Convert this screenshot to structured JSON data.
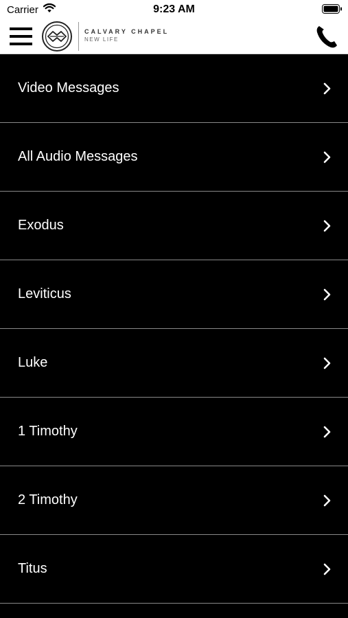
{
  "status_bar": {
    "carrier": "Carrier",
    "time": "9:23 AM",
    "wifi_icon": "wifi-icon",
    "battery_icon": "battery-icon"
  },
  "header": {
    "menu_icon": "hamburger-menu-icon",
    "logo_icon": "calvary-chapel-dove-logo",
    "brand_name": "CALVARY CHAPEL",
    "brand_sub": "NEW LIFE",
    "call_icon": "phone-icon"
  },
  "list": {
    "items": [
      {
        "label": "Video Messages"
      },
      {
        "label": "All Audio Messages"
      },
      {
        "label": "Exodus"
      },
      {
        "label": "Leviticus"
      },
      {
        "label": "Luke"
      },
      {
        "label": "1 Timothy"
      },
      {
        "label": "2 Timothy"
      },
      {
        "label": "Titus"
      }
    ],
    "chevron_icon": "chevron-right-icon"
  },
  "colors": {
    "background": "#000000",
    "header_background": "#ffffff",
    "text": "#ffffff",
    "divider": "#8a8a8a"
  }
}
